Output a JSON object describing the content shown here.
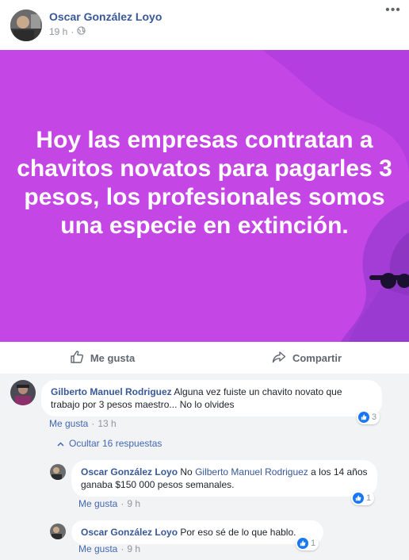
{
  "post": {
    "author": "Oscar González Loyo",
    "time": "19 h",
    "separator": "·",
    "text": "Hoy las empresas contratan a chavitos novatos para pagarles 3 pesos, los profesionales somos una especie en extinción.",
    "background_color": "#c446e5"
  },
  "actions": {
    "like": "Me gusta",
    "share": "Compartir"
  },
  "comments": [
    {
      "author": "Gilberto Manuel Rodriguez",
      "text": " Alguna vez fuiste un chavito novato que trabajo por 3 pesos maestro... No lo olvides",
      "like_label": "Me gusta",
      "time": "13 h",
      "reactions": "3"
    }
  ],
  "hide_replies": "Ocultar 16 respuestas",
  "replies": [
    {
      "author": "Oscar González Loyo",
      "prefix": " No ",
      "mention": "Gilberto Manuel Rodriguez",
      "text": " a los 14 años ganaba $150 000 pesos semanales.",
      "like_label": "Me gusta",
      "time": "9 h",
      "reactions": "1"
    },
    {
      "author": "Oscar González Loyo",
      "text": " Por eso sé de lo que hablo.",
      "like_label": "Me gusta",
      "time": "9 h",
      "reactions": "1"
    }
  ],
  "colors": {
    "link_blue": "#385898",
    "like_blue": "#1877f2",
    "meta_gray": "#90949c"
  }
}
